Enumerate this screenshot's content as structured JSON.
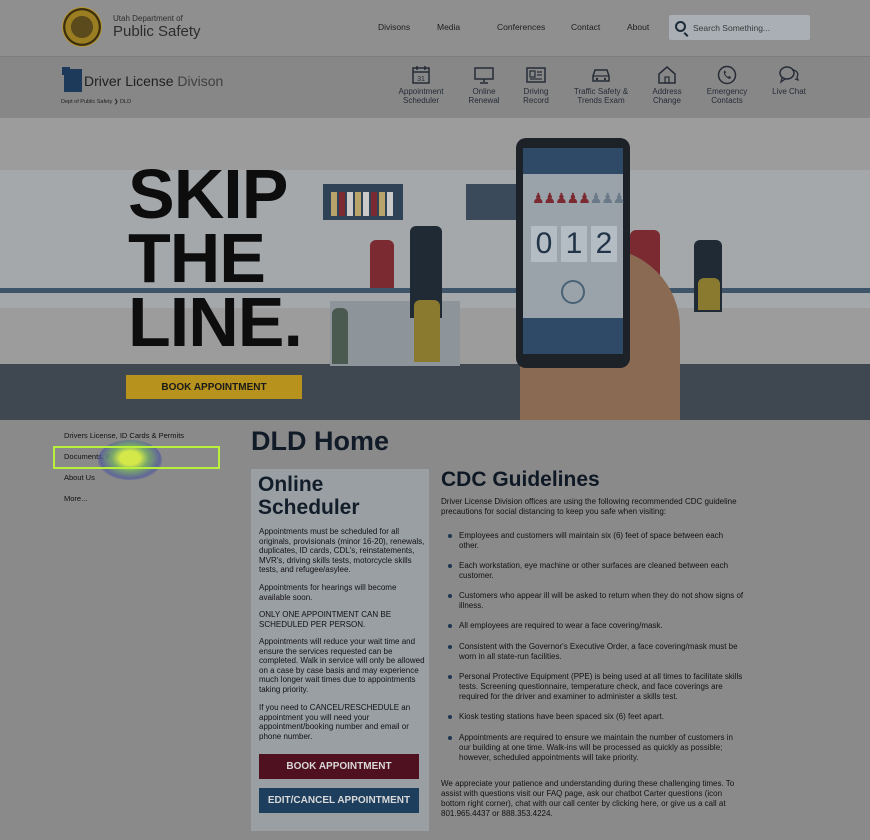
{
  "header": {
    "agency_small": "Utah Department of",
    "agency_big": "Public Safety",
    "nav": [
      "Divisons",
      "Media",
      "Conferences",
      "Contact",
      "About"
    ],
    "search_placeholder": "Search Something..."
  },
  "division": {
    "title_bold": "Driver License",
    "title_light": "Divison",
    "breadcrumb": [
      "Dept of Public Safety",
      "DLD"
    ],
    "quicklinks": [
      {
        "label": "Appointment Scheduler",
        "icon": "calendar-icon"
      },
      {
        "label": "Online Renewal",
        "icon": "monitor-icon"
      },
      {
        "label": "Driving Record",
        "icon": "id-card-icon"
      },
      {
        "label": "Traffic Safety & Trends Exam",
        "icon": "car-icon"
      },
      {
        "label": "Address Change",
        "icon": "house-icon"
      },
      {
        "label": "Emergency Contacts",
        "icon": "phone-icon"
      },
      {
        "label": "Live Chat",
        "icon": "chat-icon"
      }
    ]
  },
  "hero": {
    "headline": [
      "SKIP",
      "THE",
      "LINE."
    ],
    "button": "BOOK APPOINTMENT",
    "counter_digits": [
      "0",
      "1",
      "2"
    ]
  },
  "sidebar": {
    "items": [
      "Drivers License, ID Cards & Permits",
      "Documents, Fees & Rates",
      "About Us",
      "More..."
    ]
  },
  "main": {
    "title": "DLD Home",
    "scheduler": {
      "heading_line1": "Online",
      "heading_line2": "Scheduler",
      "paragraphs": [
        "Appointments must be scheduled for all originals, provisionals (minor 16-20), renewals, duplicates, ID cards, CDL's, reinstatements, MVR's, driving skills tests, motorcycle skills tests, and refugee/asylee.",
        "Appointments for hearings will become available soon.",
        "ONLY ONE APPOINTMENT CAN BE SCHEDULED PER PERSON.",
        "Appointments will reduce your wait time and ensure the services requested can be completed. Walk in service will only be allowed on a case by case basis and may experience much longer wait times due to appointments taking priority.",
        "If you need to CANCEL/RESCHEDULE an appointment you will need your appointment/booking number and email or phone number."
      ],
      "book_button": "BOOK APPOINTMENT",
      "edit_button": "EDIT/CANCEL APPOINTMENT"
    },
    "cdc": {
      "title": "CDC Guidelines",
      "intro": "Driver License Division offices are using the following recommended CDC guideline precautions for social distancing to keep you safe when visiting:",
      "items": [
        "Employees and customers will maintain six (6) feet of space between each other.",
        "Each workstation, eye machine or other surfaces are cleaned between each customer.",
        "Customers who appear ill will be asked to return when they do not show signs of illness.",
        "All employees are required to wear a face covering/mask.",
        "Consistent with the Governor's Executive Order, a face covering/mask must be worn in all state-run facilities.",
        "Personal Protective Equipment (PPE) is being used at all times to facilitate skills tests. Screening questionnaire, temperature check, and face coverings are required for the driver and examiner to administer a skills test.",
        "Kiosk testing stations have been spaced six (6) feet apart.",
        "Appointments are required to ensure we maintain the number of customers in our building at one time. Walk-ins will be processed as quickly as possible; however, scheduled appointments will take priority."
      ],
      "footer": "We appreciate your patience and understanding during these challenging times. To assist with questions visit our FAQ page, ask our chatbot Carter questions (icon bottom right corner), chat with our call center by clicking here, or give us a call at 801.965.4437 or 888.353.4224."
    }
  }
}
